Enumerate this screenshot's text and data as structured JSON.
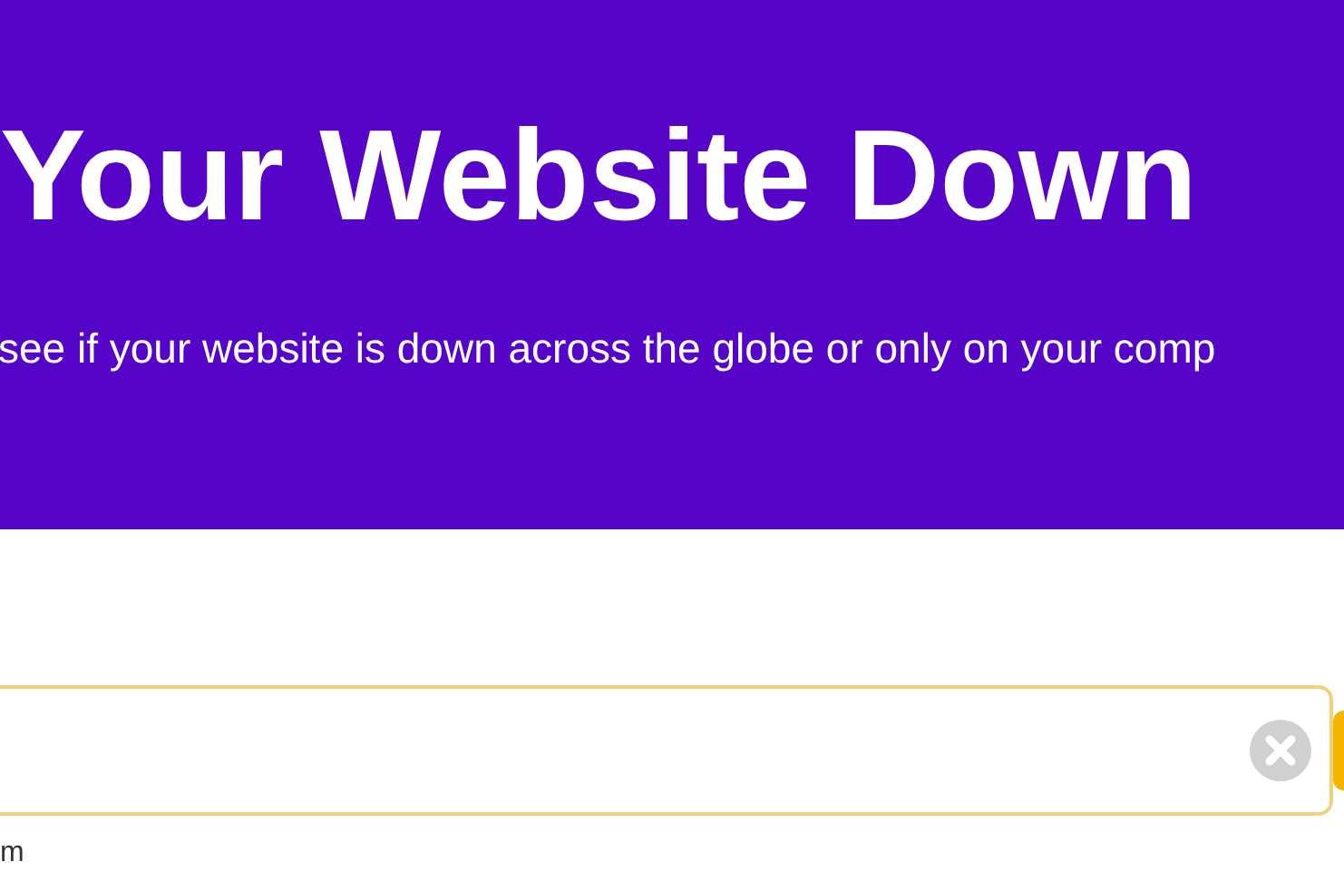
{
  "hero": {
    "title": "Your Website Down",
    "subtitle": "see if your website is down across the globe or only on your comp"
  },
  "search": {
    "hint": "m"
  }
}
